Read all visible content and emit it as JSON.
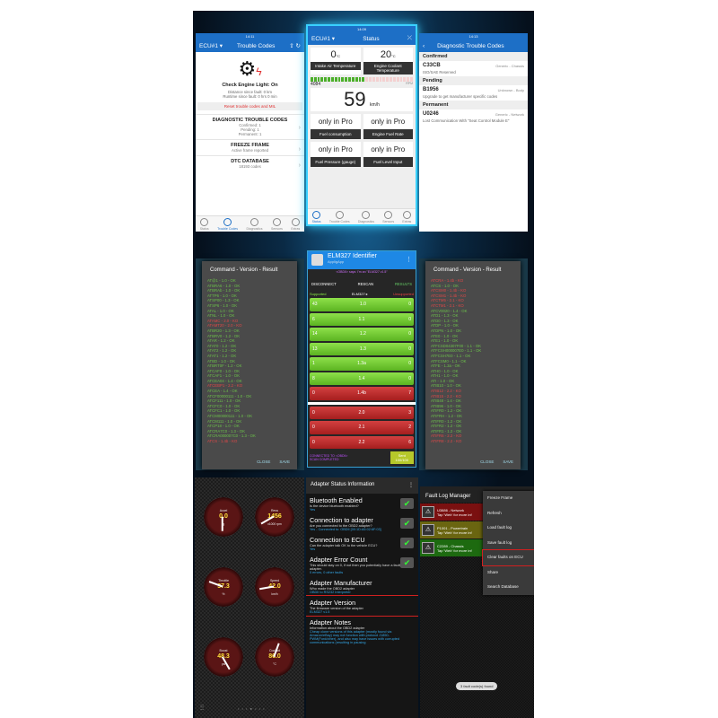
{
  "trouble_codes": {
    "status_time": "14:11",
    "ecu": "ECU#1 ▾",
    "title": "Trouble Codes",
    "check_engine": "Check Engine Light: On",
    "distance": "Distance since fault: 0 km",
    "runtime": "Runtime since fault: 0 hrs 0 min",
    "reset": "Reset trouble codes and MIL",
    "dtc_title": "DIAGNOSTIC TROUBLE CODES",
    "confirmed": "Confirmed: 1",
    "pending": "Pending: 1",
    "permanent": "Permanent: 1",
    "freeze_title": "FREEZE FRAME",
    "freeze_sub": "Active frame reported",
    "db_title": "DTC DATABASE",
    "db_sub": "18193 codes"
  },
  "tabs": [
    "Status",
    "Trouble Codes",
    "Diagnostics",
    "Sensors",
    "Extras"
  ],
  "status_screen": {
    "status_time": "14:09",
    "ecu": "ECU#1 ▾",
    "title": "Status",
    "intake_val": "0",
    "intake_unit": "°C",
    "intake_label": "Intake Air Temperature",
    "coolant_val": "20",
    "coolant_unit": "°C",
    "coolant_label": "Engine Coolant Temperature",
    "rpm": "4084",
    "rpm_unit": "RPM",
    "rpm_fraction": 0.53,
    "speed": "59",
    "speed_unit": "km/h",
    "pro": "only in Pro",
    "cells": [
      "Fuel consumption",
      "Engine Fuel Rate",
      "Fuel Pressure (gauge)",
      "Fuel Level Input"
    ]
  },
  "dtc_list": {
    "status_time": "14:13",
    "title": "Diagnostic Trouble Codes",
    "sections": [
      {
        "header": "Confirmed",
        "code": "C33CB",
        "type": "Generic - Chassis",
        "desc": "ISO/SAE Reserved"
      },
      {
        "header": "Pending",
        "code": "B1956",
        "type": "Unknown - Body",
        "desc": "Upgrade to get manufacturer specific codes"
      },
      {
        "header": "Permanent",
        "code": "U0246",
        "type": "Generic - Network",
        "desc": "Lost Communication With \"Seat Control Module E\""
      }
    ]
  },
  "cmd_left": {
    "title": "Command - Version - Result",
    "close": "CLOSE",
    "save": "SAVE",
    "items": [
      [
        "AT@1 - 1.0 - OK",
        1
      ],
      [
        "ATBRA6 - 1.0 - OK",
        1
      ],
      [
        "ATBRAb - 1.0 - OK",
        1
      ],
      [
        "ATTP6 - 1.0 - OK",
        1
      ],
      [
        "ATSP00 - 1.3 - OK",
        1
      ],
      [
        "ATSP6 - 1.0 - OK",
        1
      ],
      [
        "ATAL - 1.0 - OK",
        1
      ],
      [
        "ATNL - 1.0 - OK",
        1
      ],
      [
        "ATAMC - 2.0 - KO",
        0
      ],
      [
        "ATAMT20 - 2.0 - KO",
        0
      ],
      [
        "ATBR20 - 1.3 - OK",
        1
      ],
      [
        "ATBRV0 - 1.2 - OK",
        1
      ],
      [
        "ATAR - 1.2 - OK",
        1
      ],
      [
        "ATAT0 - 1.2 - OK",
        1
      ],
      [
        "ATAT2 - 1.2 - OK",
        1
      ],
      [
        "ATAT1 - 1.2 - OK",
        1
      ],
      [
        "ATBD - 1.0 - OK",
        1
      ],
      [
        "ATBRT0F - 1.2 - OK",
        1
      ],
      [
        "ATCAF0 - 1.0 - OK",
        1
      ],
      [
        "ATCAF1 - 1.0 - OK",
        1
      ],
      [
        "ATCEA04 - 1.4 - OK",
        1
      ],
      [
        "ATCEBP1 - 2.2 - KO",
        0
      ],
      [
        "ATCEA - 1.4 - OK",
        1
      ],
      [
        "ATCF00000111 - 1.0 - OK",
        1
      ],
      [
        "ATCF111 - 1.0 - OK",
        1
      ],
      [
        "ATCFC0 - 1.0 - OK",
        1
      ],
      [
        "ATCFC1 - 1.0 - OK",
        1
      ],
      [
        "ATCM00000111 - 1.0 - OK",
        1
      ],
      [
        "ATCM111 - 1.0 - OK",
        1
      ],
      [
        "ATCP18 - 1.0 - OK",
        1
      ],
      [
        "ATCRA7C0 - 1.3 - OK",
        1
      ],
      [
        "ATCRA000007C0 - 1.3 - OK",
        1
      ],
      [
        "ATCS - 1.4b - KO",
        0
      ]
    ]
  },
  "cmd_right": {
    "title": "Command - Version - Result",
    "close": "CLOSE",
    "save": "SAVE",
    "items": [
      [
        "ATCRA - 1.4b - KO",
        0
      ],
      [
        "ATCS - 1.0 - OK",
        1
      ],
      [
        "ATCSM0 - 1.4b - KO",
        0
      ],
      [
        "ATCSM1 - 1.4b - KO",
        0
      ],
      [
        "ATCTM5 - 2.1 - KO",
        0
      ],
      [
        "ATCTM1 - 2.1 - KO",
        0
      ],
      [
        "ATCV0020 - 1.4 - OK",
        1
      ],
      [
        "ATD1 - 1.3 - OK",
        1
      ],
      [
        "ATD0 - 1.3 - OK",
        1
      ],
      [
        "ATDP - 1.0 - OK",
        1
      ],
      [
        "ATDPN - 1.0 - OK",
        1
      ],
      [
        "ATE0 - 1.0 - OK",
        1
      ],
      [
        "ATE1 - 1.0 - OK",
        1
      ],
      [
        "ATFCSD04307F00 - 1.1 - OK",
        1
      ],
      [
        "ATFCSH000007E0 - 1.1 - OK",
        1
      ],
      [
        "ATFCSH7E0 - 1.1 - OK",
        1
      ],
      [
        "ATFCSM0 - 1.1 - OK",
        1
      ],
      [
        "ATFE - 1.3a - OK",
        1
      ],
      [
        "ATH0 - 1.0 - OK",
        1
      ],
      [
        "ATH1 - 1.0 - OK",
        1
      ],
      [
        "ATI - 1.0 - OK",
        1
      ],
      [
        "ATIB10 - 1.0 - OK",
        1
      ],
      [
        "ATIB12 - 2.2 - KO",
        0
      ],
      [
        "ATIB15 - 2.2 - KO",
        0
      ],
      [
        "ATIB48 - 1.4 - OK",
        1
      ],
      [
        "ATIB96 - 1.0 - OK",
        1
      ],
      [
        "ATIFR0 - 1.2 - OK",
        1
      ],
      [
        "ATIFRH - 1.2 - OK",
        1
      ],
      [
        "ATIFR0 - 1.2 - OK",
        1
      ],
      [
        "ATIFR2 - 1.2 - OK",
        1
      ],
      [
        "ATIFR1 - 1.2 - OK",
        1
      ],
      [
        "ATIFR6 - 2.2 - KO",
        0
      ],
      [
        "ATIFR8 - 2.2 - KO",
        0
      ]
    ]
  },
  "elm": {
    "title": "ELM327 Identifier",
    "subtitle": "AppligApp",
    "says": "<OBDII> says: I'm an \"ELM327 v1.5\"",
    "disconnect": "DISCONNECT",
    "rescan": "RESCAN",
    "results": "RESULTS",
    "supported": "Supported",
    "elm": "ELM327 ▸",
    "unsupported": "Unsupported",
    "rows": [
      [
        "43",
        "1.0",
        "0",
        1
      ],
      [
        "6",
        "1.1",
        "0",
        1
      ],
      [
        "14",
        "1.2",
        "0",
        1
      ],
      [
        "13",
        "1.3",
        "0",
        1
      ],
      [
        "1",
        "1.3a",
        "0",
        1
      ],
      [
        "8",
        "1.4",
        "0",
        1
      ],
      [
        "0",
        "1.4b",
        "7",
        0
      ],
      [
        "0",
        "2.0",
        "3",
        0
      ],
      [
        "0",
        "2.1",
        "2",
        0
      ],
      [
        "0",
        "2.2",
        "6",
        0
      ]
    ],
    "footer": "CONNECTED TO <OBDII>\nSCAN COMPLETED",
    "sent": "Sent\n100/100"
  },
  "gauges": [
    {
      "label": "Accel",
      "value": "0.0",
      "unit": "g"
    },
    {
      "label": "Revs",
      "value": "1456",
      "unit": "x1000 rpm"
    },
    {
      "label": "Throttle",
      "value": "37.3",
      "unit": "%"
    },
    {
      "label": "Speed",
      "value": "42.0",
      "unit": "km/h"
    },
    {
      "label": "Boost",
      "value": "48.3",
      "unit": "psi"
    },
    {
      "label": "Coolant",
      "value": "86.0",
      "unit": "°C"
    }
  ],
  "adapter": {
    "title": "Adapter Status Information",
    "items": [
      {
        "t": "Bluetooth Enabled",
        "d": "Is the device bluetooth enabled?",
        "v": "Yes",
        "ok": true
      },
      {
        "t": "Connection to adapter",
        "d": "Are you connected to the OBD2 adapter?",
        "v": "Yes - Connected to: OBDII [00:1D:A5:02:6F:03]",
        "ok": true
      },
      {
        "t": "Connection to ECU",
        "d": "Can the adapter talk OK to the vehicle ECU?",
        "v": "Yes",
        "ok": true
      },
      {
        "t": "Adapter Error Count",
        "d": "This should stay on 0, if not then you potentially have a faulty adapter.",
        "v": "0 errors, 0 other faults",
        "ok": true
      },
      {
        "t": "Adapter Manufacturer",
        "d": "Who made the OBD2 adapter",
        "v": "OBDII to RS232 Interpreter",
        "ok": false
      },
      {
        "t": "Adapter Version",
        "d": "The firmware version of the adapter",
        "v": "ELM327 v1.5",
        "ok": false
      },
      {
        "t": "Adapter Notes",
        "d": "Information about the OBD2 adapter",
        "v": "Cheap clone versions of this adapter (mostly found via Amazon/eBay) may not function with protocol J1850-PWM(Ford/other), and also may have issues with corrupted communications (resulting in pausing",
        "ok": false
      }
    ],
    "ok_label": "OK"
  },
  "fault_log": {
    "title": "Fault Log Manager",
    "faults": [
      {
        "code": "U3886 - Network",
        "sub": "Tap 'Web' for more inf",
        "color": "#7a1010"
      },
      {
        "code": "P1001 - Powertrain",
        "sub": "Tap 'Web' for more inf",
        "color": "#6a6510"
      },
      {
        "code": "C2289 - Chassis",
        "sub": "Tap 'Web' for more inf",
        "color": "#1d6a10"
      }
    ],
    "menu": [
      "Freeze Frame",
      "Refresh",
      "Load fault log",
      "Save fault log",
      "Clear faults on ECU",
      "Share",
      "Search Database"
    ],
    "toast": "3 fault code(s) found"
  }
}
